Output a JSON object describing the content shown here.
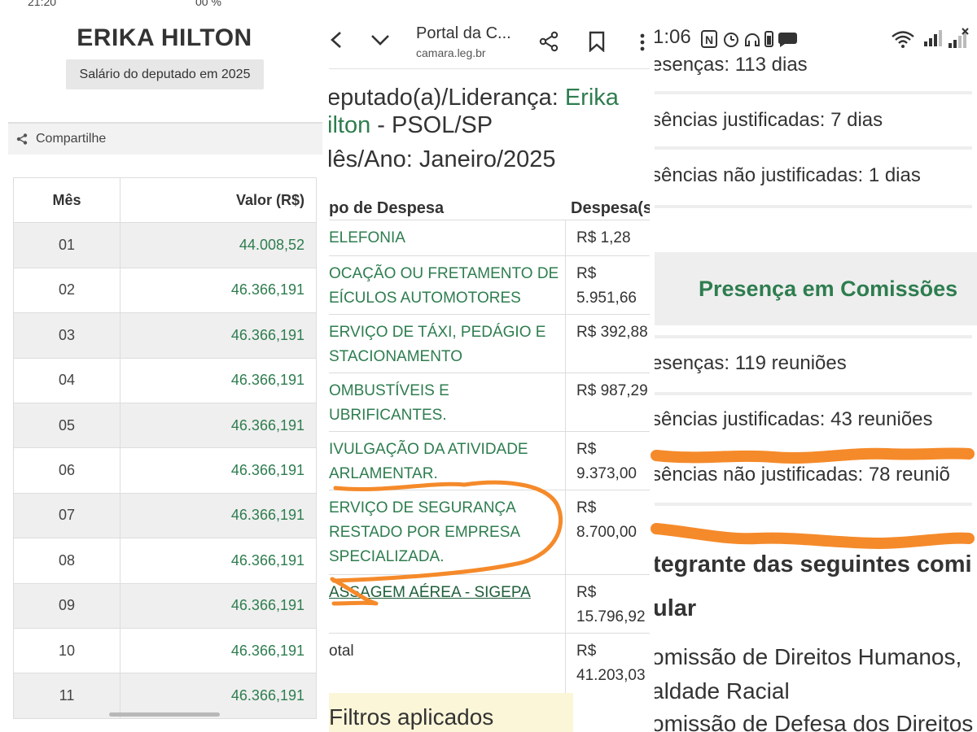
{
  "panel1": {
    "status_left": "21:20",
    "status_right": "00 %",
    "title": "ERIKA HILTON",
    "subtitle": "Salário do deputado em 2025",
    "share_label": "Compartilhe",
    "table": {
      "headers": [
        "Mês",
        "Valor (R$)"
      ],
      "rows": [
        {
          "month": "01",
          "value": "44.008,52"
        },
        {
          "month": "02",
          "value": "46.366,191"
        },
        {
          "month": "03",
          "value": "46.366,191"
        },
        {
          "month": "04",
          "value": "46.366,191"
        },
        {
          "month": "05",
          "value": "46.366,191"
        },
        {
          "month": "06",
          "value": "46.366,191"
        },
        {
          "month": "07",
          "value": "46.366,191"
        },
        {
          "month": "08",
          "value": "46.366,191"
        },
        {
          "month": "09",
          "value": "46.366,191"
        },
        {
          "month": "10",
          "value": "46.366,191"
        },
        {
          "month": "11",
          "value": "46.366,191"
        }
      ]
    }
  },
  "panel2": {
    "site_title": "Portal da C...",
    "url": "camara.leg.br",
    "line1_prefix": "eputado(a)/Liderança: ",
    "line1_name": "Erika",
    "line2_name": "ilton",
    "line2_suffix": " - PSOL/SP",
    "month_label": "lês/Ano: Janeiro/2025",
    "col_type": "po de Despesa",
    "col_value": "Despesa(s",
    "expenses": [
      {
        "lines": [
          "ELEFONIA"
        ],
        "value": [
          "R$ 1,28"
        ]
      },
      {
        "lines": [
          "OCAÇÃO OU FRETAMENTO DE",
          "EÍCULOS AUTOMOTORES"
        ],
        "value": [
          "R$",
          "5.951,66"
        ]
      },
      {
        "lines": [
          "ERVIÇO DE TÁXI, PEDÁGIO E",
          "STACIONAMENTO"
        ],
        "value": [
          "R$ 392,88"
        ]
      },
      {
        "lines": [
          "OMBUSTÍVEIS E",
          "UBRIFICANTES."
        ],
        "value": [
          "R$ 987,29"
        ]
      },
      {
        "lines": [
          "IVULGAÇÃO DA ATIVIDADE",
          "ARLAMENTAR."
        ],
        "value": [
          "R$",
          "9.373,00"
        ]
      },
      {
        "lines": [
          "ERVIÇO DE SEGURANÇA",
          "RESTADO POR EMPRESA",
          "SPECIALIZADA."
        ],
        "value": [
          "R$",
          "8.700,00"
        ]
      },
      {
        "lines": [
          "ASSAGEM AÉREA - SIGEPA"
        ],
        "value": [
          "R$",
          "15.796,92"
        ]
      },
      {
        "lines": [
          "otal"
        ],
        "value": [
          "R$",
          "41.203,03"
        ]
      }
    ],
    "filters_heading": "Filtros aplicados"
  },
  "panel3": {
    "time": "1:06",
    "rows_top": [
      "esenças:  113 dias",
      "sências justificadas:  7 dias",
      "sências não justificadas:  1 dias"
    ],
    "band_title": "Presença em Comissões",
    "rows_mid": [
      "esenças:  119 reuniões",
      "sências justificadas:  43 reuniões",
      "sências não justificadas:  78 reuniõ"
    ],
    "heading_line1": "tegrante das seguintes comi",
    "heading_line2": "ular",
    "list_lines": [
      "omissão de Direitos Humanos,",
      "aldade Racial",
      "omissão de Defesa dos Direitos"
    ]
  },
  "colors": {
    "green_text": "#2e7d4f",
    "highlighter": "#f58a2a",
    "stripe": "#efefef",
    "band": "#eeeeee",
    "filter_bg": "#fbf6d8"
  },
  "icons": [
    "share-icon",
    "back-icon",
    "chevron-down-icon",
    "bookmark-icon",
    "more-icon",
    "wifi-icon",
    "signal-icon"
  ]
}
